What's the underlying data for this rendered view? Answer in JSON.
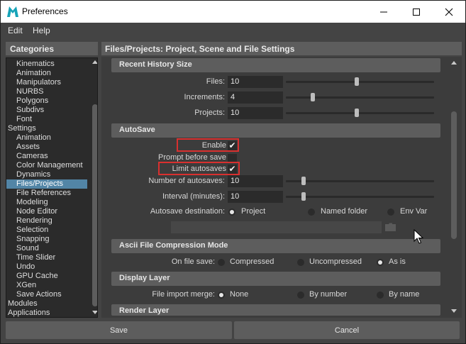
{
  "window": {
    "title": "Preferences",
    "controls": {
      "minimize": "—",
      "maximize": "☐",
      "close": "✕"
    }
  },
  "menu": [
    "Edit",
    "Help"
  ],
  "categories": {
    "title": "Categories",
    "items": [
      {
        "label": "Kinematics",
        "indent": 1
      },
      {
        "label": "Animation",
        "indent": 1
      },
      {
        "label": "Manipulators",
        "indent": 1
      },
      {
        "label": "NURBS",
        "indent": 1
      },
      {
        "label": "Polygons",
        "indent": 1
      },
      {
        "label": "Subdivs",
        "indent": 1
      },
      {
        "label": "Font",
        "indent": 1
      },
      {
        "label": "Settings",
        "indent": 0
      },
      {
        "label": "Animation",
        "indent": 1
      },
      {
        "label": "Assets",
        "indent": 1
      },
      {
        "label": "Cameras",
        "indent": 1
      },
      {
        "label": "Color Management",
        "indent": 1
      },
      {
        "label": "Dynamics",
        "indent": 1
      },
      {
        "label": "Files/Projects",
        "indent": 1,
        "selected": true
      },
      {
        "label": "File References",
        "indent": 1
      },
      {
        "label": "Modeling",
        "indent": 1
      },
      {
        "label": "Node Editor",
        "indent": 1
      },
      {
        "label": "Rendering",
        "indent": 1
      },
      {
        "label": "Selection",
        "indent": 1
      },
      {
        "label": "Snapping",
        "indent": 1
      },
      {
        "label": "Sound",
        "indent": 1
      },
      {
        "label": "Time Slider",
        "indent": 1
      },
      {
        "label": "Undo",
        "indent": 1
      },
      {
        "label": "GPU Cache",
        "indent": 1
      },
      {
        "label": "XGen",
        "indent": 1
      },
      {
        "label": "Save Actions",
        "indent": 1
      },
      {
        "label": "Modules",
        "indent": 0
      },
      {
        "label": "Applications",
        "indent": 0
      }
    ]
  },
  "settings": {
    "title": "Files/Projects: Project, Scene and File Settings",
    "recent_history": {
      "title": "Recent History Size",
      "files": {
        "label": "Files:",
        "value": "10",
        "slider": 0.48
      },
      "increments": {
        "label": "Increments:",
        "value": "4",
        "slider": 0.17
      },
      "projects": {
        "label": "Projects:",
        "value": "10",
        "slider": 0.48
      }
    },
    "autosave": {
      "title": "AutoSave",
      "enable": {
        "label": "Enable",
        "checked": "✔"
      },
      "prompt": {
        "label": "Prompt before save",
        "checked": ""
      },
      "limit": {
        "label": "Limit autosaves",
        "checked": "✔"
      },
      "number": {
        "label": "Number of autosaves:",
        "value": "10",
        "slider": 0.11
      },
      "interval": {
        "label": "Interval (minutes):",
        "value": "10",
        "slider": 0.11
      },
      "destination": {
        "label": "Autosave destination:",
        "options": [
          "Project",
          "Named folder",
          "Env Var"
        ],
        "selected": "Project"
      }
    },
    "ascii": {
      "title": "Ascii File Compression Mode",
      "label": "On file save:",
      "options": [
        "Compressed",
        "Uncompressed",
        "As is"
      ],
      "selected": "As is"
    },
    "display_layer": {
      "title": "Display Layer",
      "label": "File import merge:",
      "options": [
        "None",
        "By number",
        "By name"
      ],
      "selected": "None"
    },
    "render_layer": {
      "title": "Render Layer"
    }
  },
  "buttons": {
    "save": "Save",
    "cancel": "Cancel"
  },
  "colors": {
    "highlight": "#d9302f",
    "selection": "#5285a6",
    "panel": "#444444",
    "field": "#2b2b2b"
  }
}
